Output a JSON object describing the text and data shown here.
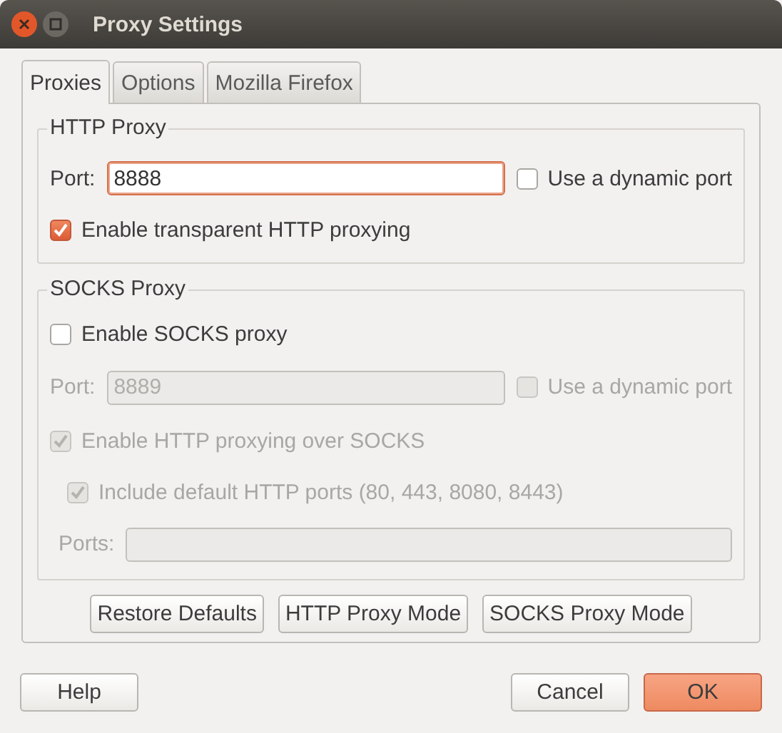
{
  "window": {
    "title": "Proxy Settings"
  },
  "tabs": [
    {
      "label": "Proxies",
      "selected": true
    },
    {
      "label": "Options",
      "selected": false
    },
    {
      "label": "Mozilla Firefox",
      "selected": false
    }
  ],
  "http_proxy": {
    "title": "HTTP Proxy",
    "port_label": "Port:",
    "port": "8888",
    "focused": true,
    "disabled": false,
    "dynamic_port": {
      "label": "Use a dynamic port",
      "checked": false
    },
    "transparent": {
      "label": "Enable transparent HTTP proxying",
      "checked": true
    }
  },
  "socks_proxy": {
    "title": "SOCKS Proxy",
    "enable": {
      "label": "Enable SOCKS proxy",
      "checked": false
    },
    "port_label": "Port:",
    "port": "8889",
    "disabled": true,
    "dynamic_port": {
      "label": "Use a dynamic port",
      "checked": false
    },
    "http_over_socks": {
      "label": "Enable HTTP proxying over SOCKS",
      "checked": true
    },
    "include_default_ports": {
      "label": "Include default HTTP ports (80, 443, 8080, 8443)",
      "checked": true
    },
    "ports_label": "Ports:"
  },
  "mode_buttons": [
    "Restore Defaults",
    "HTTP Proxy Mode",
    "SOCKS Proxy Mode"
  ],
  "footer": {
    "help": "Help",
    "cancel": "Cancel",
    "ok": "OK"
  }
}
